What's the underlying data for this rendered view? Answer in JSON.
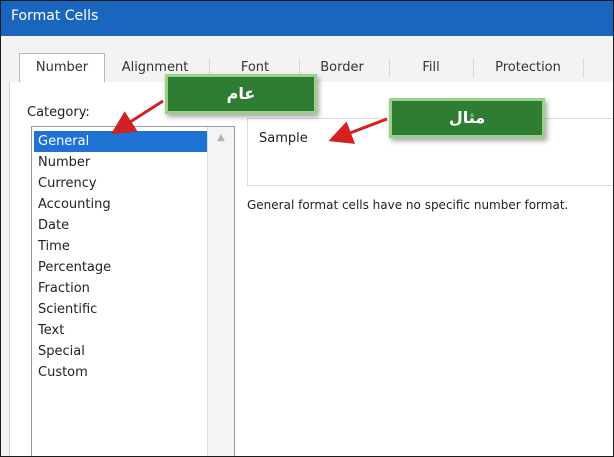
{
  "window": {
    "title": "Format Cells"
  },
  "tabs": [
    {
      "label": "Number"
    },
    {
      "label": "Alignment"
    },
    {
      "label": "Font"
    },
    {
      "label": "Border"
    },
    {
      "label": "Fill"
    },
    {
      "label": "Protection"
    }
  ],
  "category": {
    "label": "Category:",
    "items": [
      "General",
      "Number",
      "Currency",
      "Accounting",
      "Date",
      "Time",
      "Percentage",
      "Fraction",
      "Scientific",
      "Text",
      "Special",
      "Custom"
    ],
    "selected": "General"
  },
  "sample": {
    "label": "Sample"
  },
  "description": "General format cells have no specific number format.",
  "annotations": {
    "general": "عام",
    "sample": "مثال"
  },
  "colors": {
    "titlebar": "#1a66bf",
    "selection": "#1e72d3",
    "callout": "#2e7d32",
    "arrow": "#d32020"
  },
  "icons": {
    "scroll_up": "chevron-up-icon"
  }
}
